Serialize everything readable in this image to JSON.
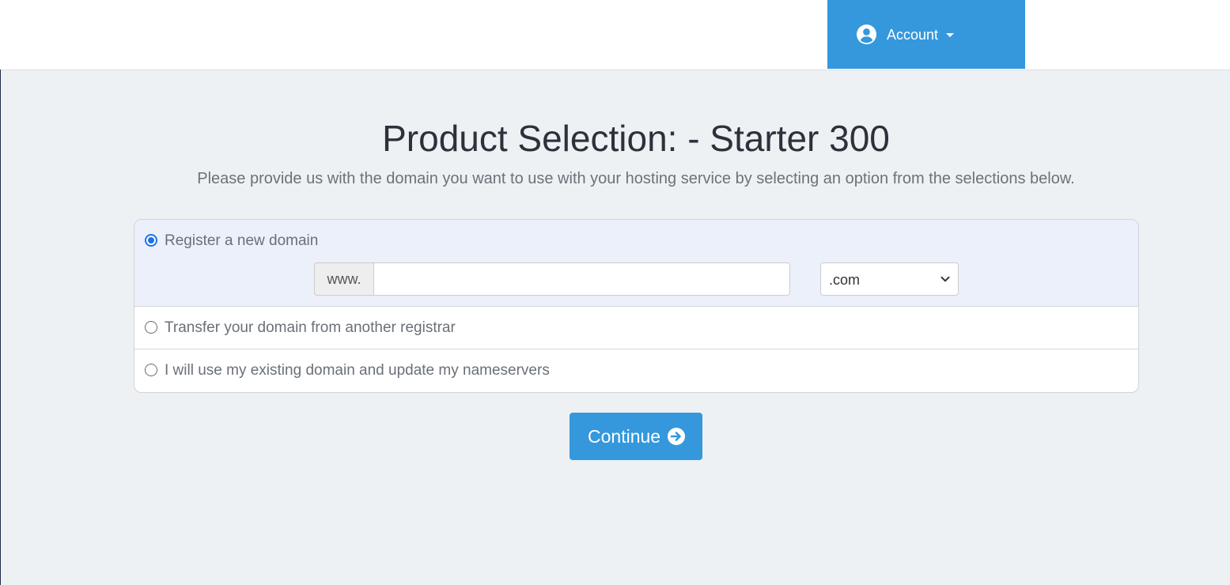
{
  "header": {
    "account_label": "Account",
    "accent_color": "#3598dc",
    "user_icon": "user-circle-icon",
    "caret_icon": "caret-down-icon"
  },
  "main": {
    "title": "Product Selection: - Starter 300",
    "subtitle": "Please provide us with the domain you want to use with your hosting service by selecting an option from the selections below."
  },
  "domain_options": [
    {
      "label": "Register a new domain",
      "selected": true
    },
    {
      "label": "Transfer your domain from another registrar",
      "selected": false
    },
    {
      "label": "I will use my existing domain and update my nameservers",
      "selected": false
    }
  ],
  "register": {
    "prefix": "www.",
    "domain_value": "",
    "domain_placeholder": "",
    "tld_selected": ".com"
  },
  "actions": {
    "continue_label": "Continue",
    "continue_icon": "arrow-circle-right-icon"
  }
}
